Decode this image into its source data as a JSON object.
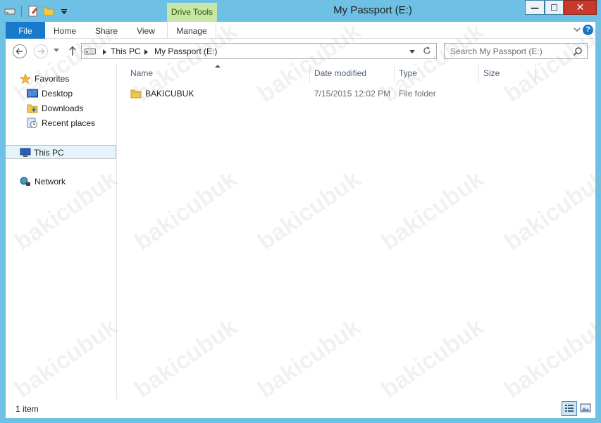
{
  "window": {
    "title": "My Passport (E:)",
    "context_tab": "Drive Tools",
    "buttons": {
      "minimize": "—",
      "maximize": "☐",
      "close": "✕"
    }
  },
  "ribbon": {
    "tabs": [
      {
        "label": "File",
        "active": true
      },
      {
        "label": "Home"
      },
      {
        "label": "Share"
      },
      {
        "label": "View"
      },
      {
        "label": "Manage"
      }
    ],
    "help": "?"
  },
  "nav": {
    "breadcrumb": [
      "This PC",
      "My Passport (E:)"
    ],
    "search_placeholder": "Search My Passport (E:)"
  },
  "navpane": {
    "items": [
      {
        "label": "Favorites",
        "icon": "star-icon"
      },
      {
        "label": "Desktop",
        "icon": "desktop-icon"
      },
      {
        "label": "Downloads",
        "icon": "downloads-icon"
      },
      {
        "label": "Recent places",
        "icon": "recent-places-icon"
      },
      {
        "label": "This PC",
        "icon": "computer-icon",
        "selected": true
      },
      {
        "label": "Network",
        "icon": "network-icon"
      }
    ]
  },
  "files": {
    "columns": [
      "Name",
      "Date modified",
      "Type",
      "Size"
    ],
    "rows": [
      {
        "name": "BAKICUBUK",
        "date_modified": "7/15/2015 12:02 PM",
        "type": "File folder",
        "size": ""
      }
    ]
  },
  "status": {
    "item_count": "1 item"
  },
  "watermark": "bakicubuk",
  "colors": {
    "accent": "#1979ca",
    "frame": "#6ec0e4",
    "context_tab": "#c8e6a5",
    "close": "#c7392b"
  }
}
